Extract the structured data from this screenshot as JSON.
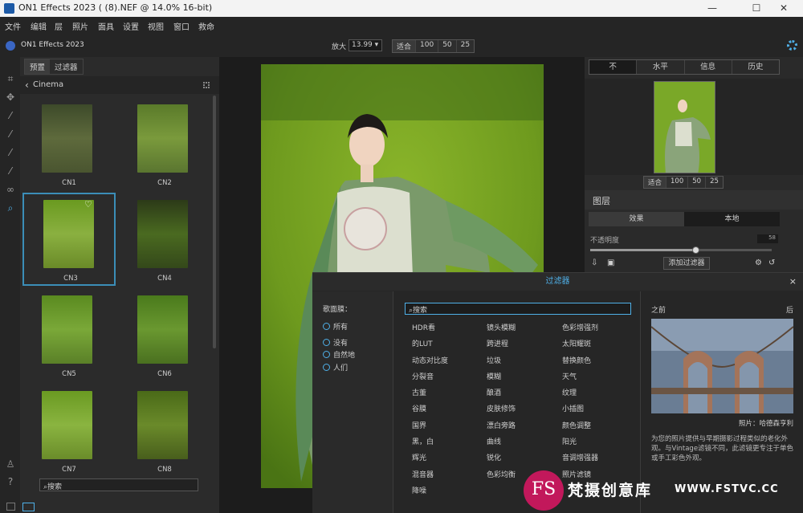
{
  "window": {
    "title": "ON1 Effects 2023 ( (8).NEF @ 14.0% 16-bit)",
    "controls": [
      "—",
      "☐",
      "✕"
    ]
  },
  "menu": [
    "文件",
    "编辑",
    "层",
    "照片",
    "面具",
    "设置",
    "视图",
    "窗口",
    "救命"
  ],
  "topbar": {
    "app_name": "ON1 Effects 2023",
    "zoom_label": "放大",
    "zoom_value": "13.99",
    "zoom_buttons": [
      "适合",
      "100",
      "50",
      "25"
    ]
  },
  "left_panel": {
    "tabs": [
      "预置",
      "过滤器"
    ],
    "category": "Cinema",
    "presets": [
      "CN1",
      "CN2",
      "CN3",
      "CN4",
      "CN5",
      "CN6",
      "CN7",
      "CN8"
    ],
    "selected": "CN3",
    "search_placeholder": "搜索"
  },
  "right_panel": {
    "tabs": [
      "不",
      "水平",
      "信息",
      "历史"
    ],
    "nav_zoom": [
      "适合",
      "100",
      "50",
      "25"
    ],
    "layers_title": "图层",
    "layer_tabs": [
      "效果",
      "本地"
    ],
    "opacity_label": "不透明度",
    "opacity_value": "58",
    "add_filter": "添加过滤器"
  },
  "filter_dialog": {
    "title": "过滤器",
    "close": "×",
    "left_header": "歌面膜：",
    "radios": [
      "所有",
      "没有",
      "自然地",
      "人们"
    ],
    "search_placeholder": "搜索",
    "col1": [
      "HDR看",
      "的LUT",
      "动态对比度",
      "分裂音",
      "古董",
      "谷膜",
      "国界",
      "黑，白",
      "辉光",
      "混音器",
      "降噪"
    ],
    "col2": [
      "镜头模糊",
      "跨进程",
      "垃圾",
      "模糊",
      "酿酒",
      "皮肤修饰",
      "漂白旁路",
      "曲线",
      "锐化",
      "色彩均衡"
    ],
    "col3": [
      "色彩增强剂",
      "太阳耀斑",
      "替换颜色",
      "天气",
      "纹理",
      "小插图",
      "颜色调整",
      "阳光",
      "音调增强器",
      "照片滤镜"
    ],
    "preview_before": "之前",
    "preview_after": "后",
    "credit": "照片：哈德森亨利",
    "description": "为您的照片提供与早期摄影过程类似的老化外观。与Vintage滤镜不同，此滤镜更专注于单色或手工彩色外观。"
  },
  "watermark": {
    "logo": "FS",
    "name": "梵摄创意库",
    "url": "WWW.FSTVC.CC"
  },
  "colors": {
    "accent": "#4fb0e8",
    "selection": "#3b8eb8",
    "bg": "#1e1e1e"
  }
}
